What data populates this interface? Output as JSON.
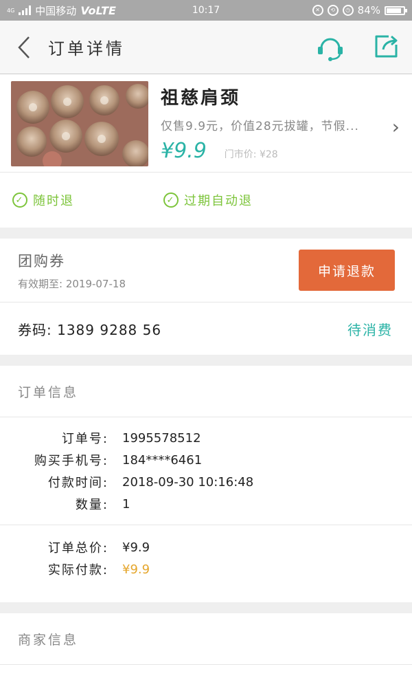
{
  "status_bar": {
    "carrier": "中国移动",
    "network": "VoLTE",
    "network_small": "4G",
    "time": "10:17",
    "battery": "84%",
    "battery_level": 0.84
  },
  "header": {
    "title": "订单详情"
  },
  "product": {
    "name": "祖慈肩颈",
    "description": "仅售9.9元，价值28元拔罐，节假...",
    "price": "¥9.9",
    "market_price_label": "门市价:",
    "market_price": "¥28"
  },
  "guarantees": [
    "随时退",
    "过期自动退"
  ],
  "voucher": {
    "title": "团购券",
    "expiry": "有效期至: 2019-07-18",
    "refund_button": "申请退款",
    "code_label": "券码:",
    "code": "1389 9288 56",
    "status": "待消费"
  },
  "order_info": {
    "title": "订单信息",
    "rows": [
      {
        "label": "订单号:",
        "value": "1995578512"
      },
      {
        "label": "购买手机号:",
        "value": "184****6461"
      },
      {
        "label": "付款时间:",
        "value": "2018-09-30 10:16:48"
      },
      {
        "label": "数量:",
        "value": "1"
      }
    ],
    "total_label": "订单总价:",
    "total_value": "¥9.9",
    "paid_label": "实际付款:",
    "paid_value": "¥9.9"
  },
  "merchant": {
    "title": "商家信息"
  },
  "colors": {
    "accent": "#2ab3a6",
    "refund": "#e3693a",
    "guarantee": "#7cc43a",
    "paid": "#e5a62c"
  }
}
